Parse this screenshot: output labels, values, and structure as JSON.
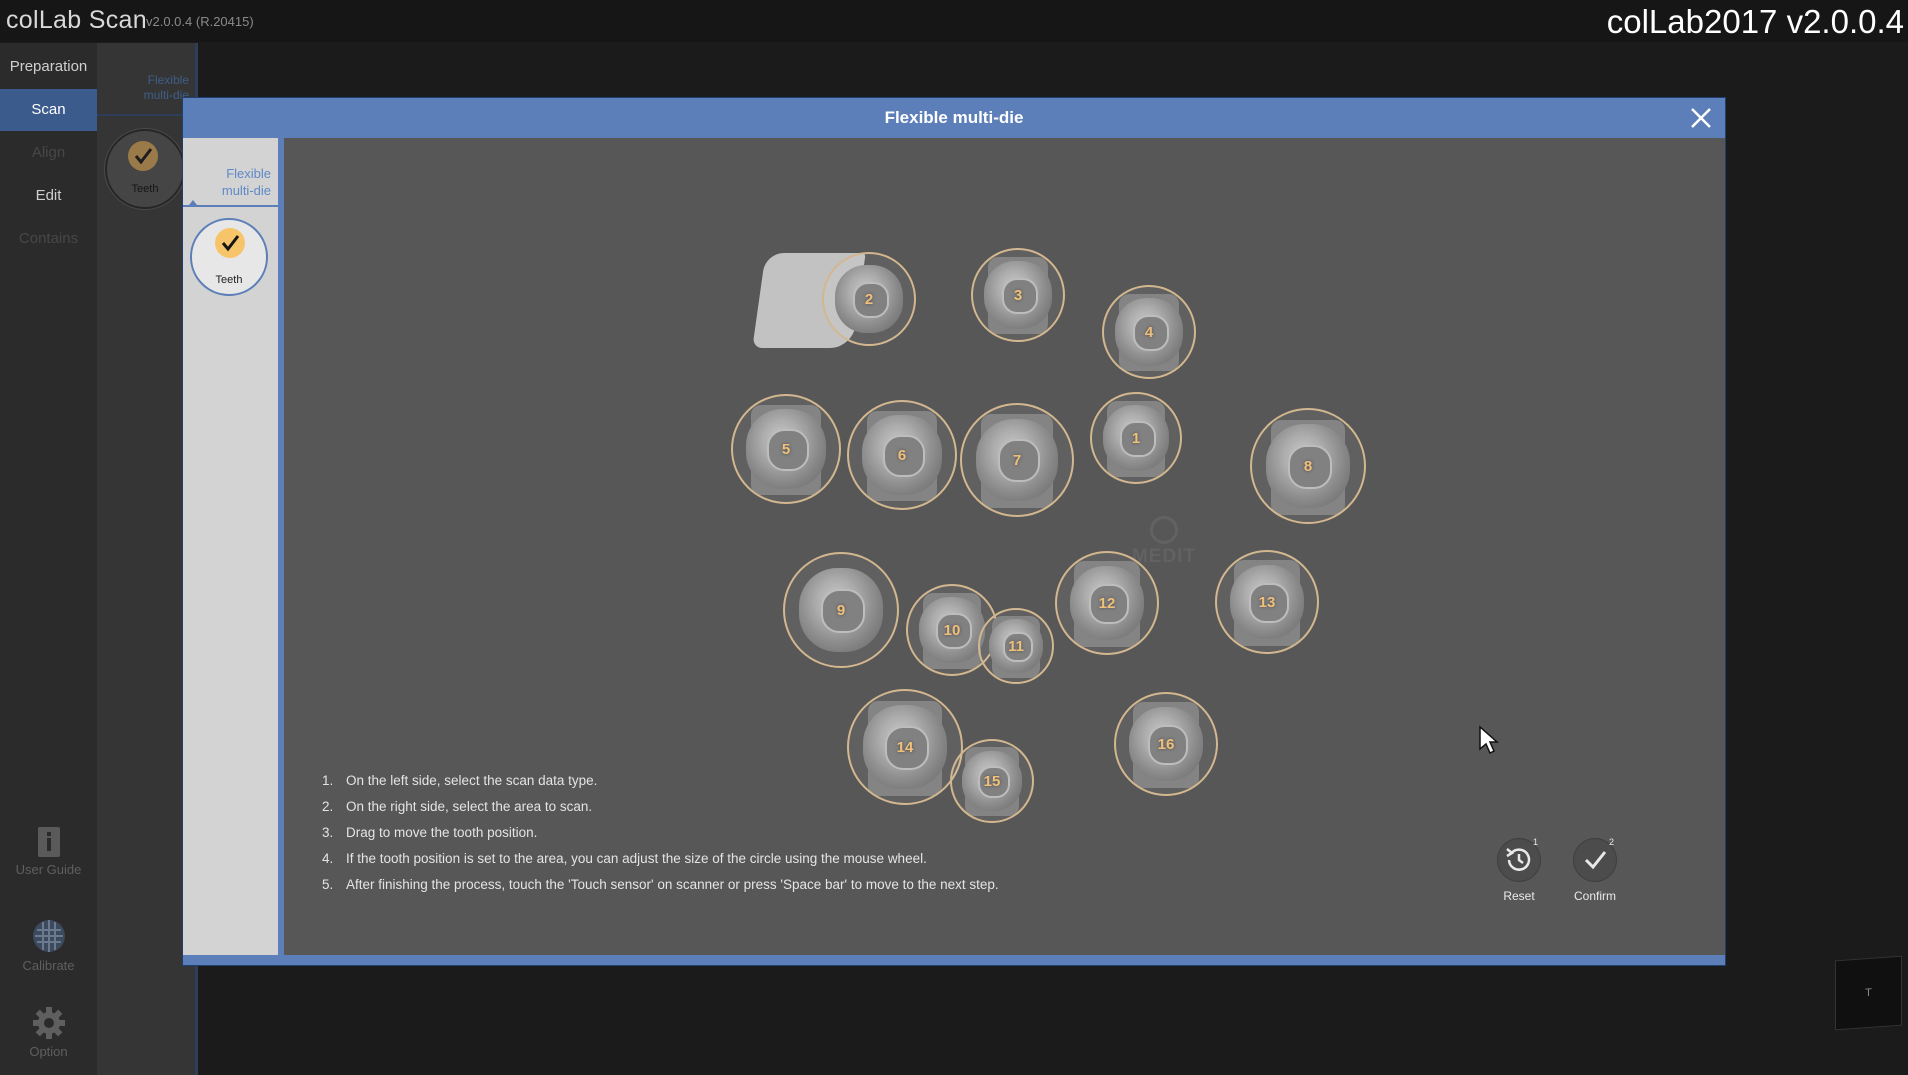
{
  "app": {
    "logo": "colLab Scan",
    "version": "v2.0.0.4 (R.20415)",
    "window_title": "colLab2017 v2.0.0.4"
  },
  "nav": {
    "items": [
      {
        "label": "Preparation",
        "state": "normal"
      },
      {
        "label": "Scan",
        "state": "active"
      },
      {
        "label": "Align",
        "state": "disabled"
      },
      {
        "label": "Edit",
        "state": "normal"
      },
      {
        "label": "Contains",
        "state": "disabled"
      }
    ],
    "tools": [
      {
        "label": "User Guide",
        "icon": "book-icon"
      },
      {
        "label": "Calibrate",
        "icon": "calibrate-icon"
      },
      {
        "label": "Option",
        "icon": "gear-icon"
      }
    ]
  },
  "subpanel": {
    "tab_label": "Flexible multi-die",
    "chip_label": "Teeth"
  },
  "modal": {
    "title": "Flexible multi-die",
    "side_tab": "Flexible multi-die",
    "data_type_label": "Teeth",
    "watermark": "MEDIT",
    "teeth": [
      "1",
      "2",
      "3",
      "4",
      "5",
      "6",
      "7",
      "8",
      "9",
      "10",
      "11",
      "12",
      "13",
      "14",
      "15",
      "16"
    ],
    "instructions": [
      {
        "n": "1.",
        "text": "On the left side, select the scan data type."
      },
      {
        "n": "2.",
        "text": "On the right side, select the area to scan."
      },
      {
        "n": "3.",
        "text": "Drag to move the tooth position."
      },
      {
        "n": "4.",
        "text": "If the tooth position is set to the area, you can adjust the size of the circle using the mouse wheel."
      },
      {
        "n": "5.",
        "text": "After finishing the process, touch the 'Touch sensor' on scanner or press 'Space bar' to move to the next step."
      }
    ],
    "actions": {
      "reset": {
        "label": "Reset",
        "badge": "1",
        "icon": "history-icon"
      },
      "confirm": {
        "label": "Confirm",
        "badge": "2",
        "icon": "check-icon"
      }
    }
  },
  "view_cube": {
    "face": "T"
  },
  "colors": {
    "accent": "#5d7fb9",
    "active_nav": "#3a5b8c",
    "ring": "#d2b78f",
    "tooth_number": "#f0c07a",
    "check": "#f7c46a"
  }
}
